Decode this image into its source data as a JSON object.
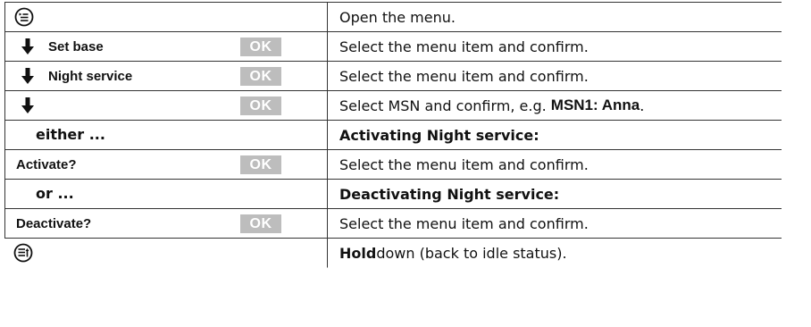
{
  "rows": [
    {
      "text": "Open the menu.",
      "icon": "menu-open-key-icon"
    },
    {
      "label": "Set base",
      "ok": "OK",
      "text": "Select the menu item and confirm.",
      "icon": "down-arrow-icon"
    },
    {
      "label": "Night service",
      "ok": "OK",
      "text": "Select the menu item and confirm.",
      "icon": "down-arrow-icon"
    },
    {
      "ok": "OK",
      "text_before": "Select MSN and confirm, e.g. ",
      "text_bold": "MSN1: Anna",
      "text_after": ".",
      "icon": "down-arrow-icon"
    },
    {
      "left_heading": "either ...",
      "right_heading": "Activating Night service:"
    },
    {
      "label": "Activate?",
      "ok": "OK",
      "text": "Select the menu item and confirm."
    },
    {
      "left_heading": "or ...",
      "right_heading": "Deactivating Night service:"
    },
    {
      "label": "Deactivate?",
      "ok": "OK",
      "text": "Select the menu item and confirm."
    },
    {
      "text_bold": "Hold",
      "text_after": " down (back to idle status).",
      "icon": "end-call-key-icon"
    }
  ]
}
